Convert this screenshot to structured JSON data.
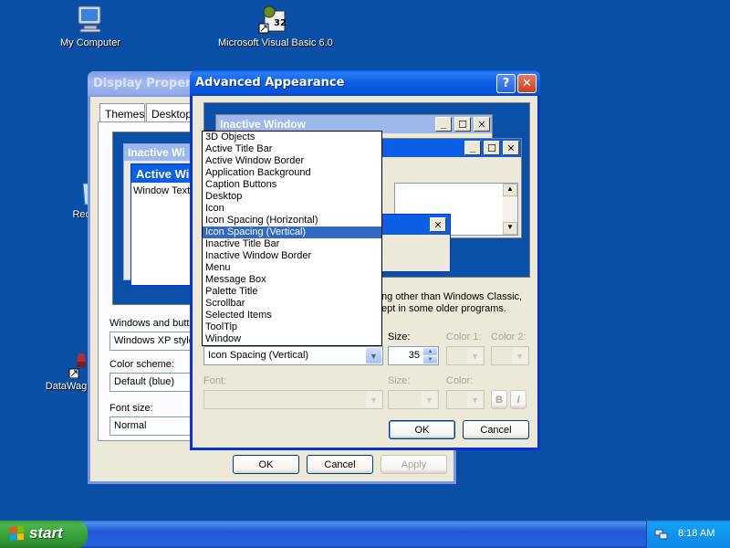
{
  "desktop": {
    "icons": [
      {
        "label": "My Computer"
      },
      {
        "label": "Microsoft Visual Basic 6.0"
      },
      {
        "label": "Recy"
      },
      {
        "label": "DataWag"
      }
    ]
  },
  "display_properties": {
    "title": "Display Propertie",
    "tabs": [
      "Themes",
      "Desktop"
    ],
    "preview": {
      "inactive_title": "Inactive Wi",
      "active_title": "Active Wi",
      "window_text": "Window Text"
    },
    "windows_buttons_label": "Windows and butt",
    "windows_buttons_value": "Windows XP style",
    "color_scheme_label": "Color scheme:",
    "color_scheme_value": "Default (blue)",
    "font_size_label": "Font size:",
    "font_size_value": "Normal",
    "ok": "OK",
    "cancel": "Cancel",
    "apply": "Apply"
  },
  "advanced_appearance": {
    "title": "Advanced Appearance",
    "help_icon": "?",
    "close_icon": "✕",
    "preview": {
      "inactive_title": "Inactive Window",
      "min": "_",
      "max": "☐",
      "close": "✕"
    },
    "note_line1": "ng other than Windows Classic,",
    "note_line2": "ept in some older programs.",
    "item_options": [
      "3D Objects",
      "Active Title Bar",
      "Active Window Border",
      "Application Background",
      "Caption Buttons",
      "Desktop",
      "Icon",
      "Icon Spacing (Horizontal)",
      "Icon Spacing (Vertical)",
      "Inactive Title Bar",
      "Inactive Window Border",
      "Menu",
      "Message Box",
      "Palette Title",
      "Scrollbar",
      "Selected Items",
      "ToolTip",
      "Window"
    ],
    "item_selected": "Icon Spacing (Vertical)",
    "size_label": "Size:",
    "size_value": "35",
    "color1_label": "Color 1:",
    "color2_label": "Color 2:",
    "font_label": "Font:",
    "font_size_label": "Size:",
    "font_color_label": "Color:",
    "bold_label": "B",
    "italic_label": "I",
    "ok": "OK",
    "cancel": "Cancel"
  },
  "taskbar": {
    "start_label": "start",
    "clock": "8:18 AM"
  },
  "colors": {
    "desktop": "#0a4fa6",
    "selection": "#316ac5",
    "titlebar_active": "#0a5fe4"
  }
}
